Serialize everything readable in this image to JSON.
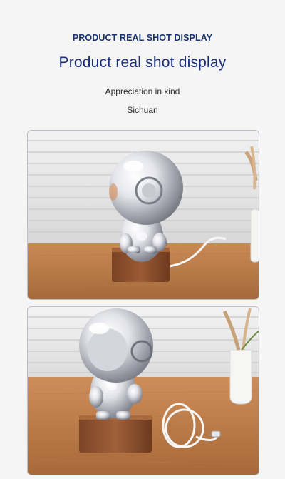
{
  "header": {
    "kicker": "PRODUCT REAL SHOT DISPLAY",
    "title": "Product real shot display",
    "subtitle_1": "Appreciation in kind",
    "subtitle_2": "Sichuan"
  },
  "colors": {
    "heading_navy": "#1a2d78",
    "background": "#f5f5f5",
    "wood_table": "#b8794a",
    "chrome": "#d9dbe2"
  }
}
